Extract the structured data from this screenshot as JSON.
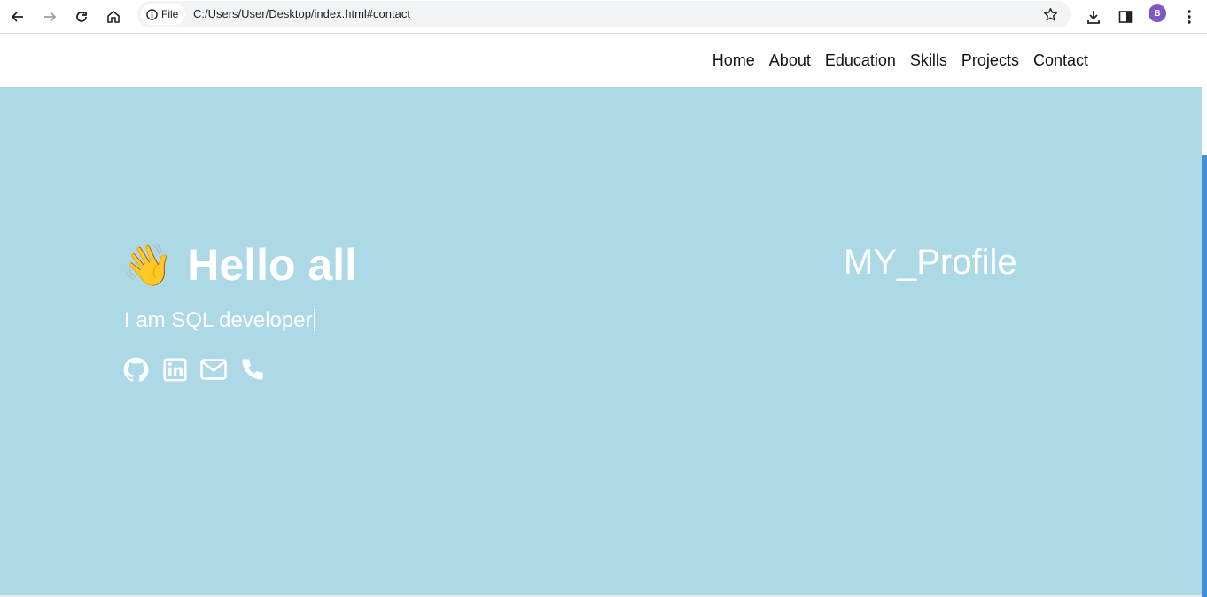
{
  "browser": {
    "chip_label": "File",
    "url": "C:/Users/User/Desktop/index.html#contact",
    "profile_initial": "B"
  },
  "nav": {
    "links": [
      "Home",
      "About",
      "Education",
      "Skills",
      "Projects",
      "Contact"
    ]
  },
  "hero": {
    "wave_emoji": "👋",
    "greeting": "Hello all",
    "role_text": "I am SQL developer",
    "social_icons": [
      "github-icon",
      "linkedin-icon",
      "mail-icon",
      "phone-icon"
    ],
    "profile_title": "MY_Profile"
  },
  "colors": {
    "hero_background": "#add8e6",
    "text": "#ffffff",
    "scrollbar": "#3d8fd8",
    "avatar": "#7e57c2"
  }
}
